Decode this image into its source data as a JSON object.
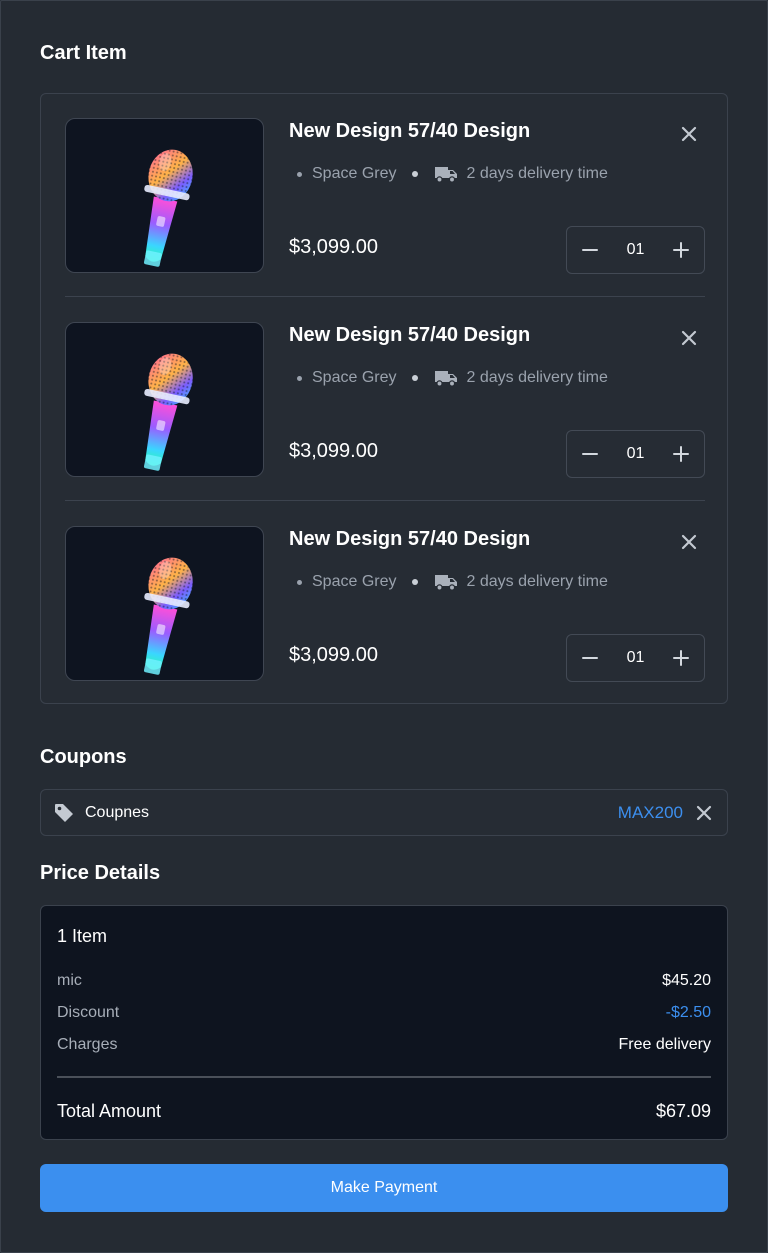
{
  "cart": {
    "title": "Cart Item",
    "items": [
      {
        "name": "New Design 57/40 Design",
        "color": "Space Grey",
        "delivery": "2 days delivery time",
        "price": "$3,099.00",
        "quantity": "01"
      },
      {
        "name": "New Design 57/40 Design",
        "color": "Space Grey",
        "delivery": "2 days delivery time",
        "price": "$3,099.00",
        "quantity": "01"
      },
      {
        "name": "New Design 57/40 Design",
        "color": "Space Grey",
        "delivery": "2 days delivery time",
        "price": "$3,099.00",
        "quantity": "01"
      }
    ]
  },
  "coupons": {
    "title": "Coupons",
    "label": "Coupnes",
    "code": "MAX200"
  },
  "price_details": {
    "title": "Price Details",
    "item_count": "1 Item",
    "rows": [
      {
        "label": "mic",
        "value": "$45.20"
      },
      {
        "label": "Discount",
        "value": "-$2.50"
      },
      {
        "label": "Charges",
        "value": "Free delivery"
      }
    ],
    "total_label": "Total Amount",
    "total_value": "$67.09"
  },
  "actions": {
    "pay_label": "Make Payment"
  },
  "colors": {
    "background": "#252b33",
    "panel": "#0e141f",
    "accent": "#3b8fef",
    "muted_text": "#9aa2ad"
  },
  "icons": {
    "product_image": "microphone-image",
    "remove": "close-icon",
    "delivery": "truck-icon",
    "decrease": "minus-icon",
    "increase": "plus-icon",
    "coupon": "tag-icon"
  }
}
